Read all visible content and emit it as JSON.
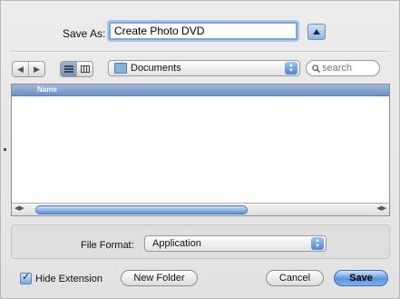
{
  "dialog": {
    "save_as_label": "Save As:",
    "filename": "Create Photo DVD"
  },
  "toolbar": {
    "back_icon": "chevron-left-icon",
    "forward_icon": "chevron-right-icon",
    "list_view_icon": "list-view-icon",
    "column_view_icon": "column-view-icon",
    "location": "Documents",
    "search_placeholder": "search"
  },
  "browser": {
    "columns": [
      "Name"
    ],
    "rows": []
  },
  "format": {
    "label": "File Format:",
    "value": "Application"
  },
  "footer": {
    "hide_extension_label": "Hide Extension",
    "hide_extension_checked": true,
    "new_folder_label": "New Folder",
    "cancel_label": "Cancel",
    "save_label": "Save"
  },
  "colors": {
    "accent": "#5d95dc",
    "header": "#6e91c4"
  }
}
